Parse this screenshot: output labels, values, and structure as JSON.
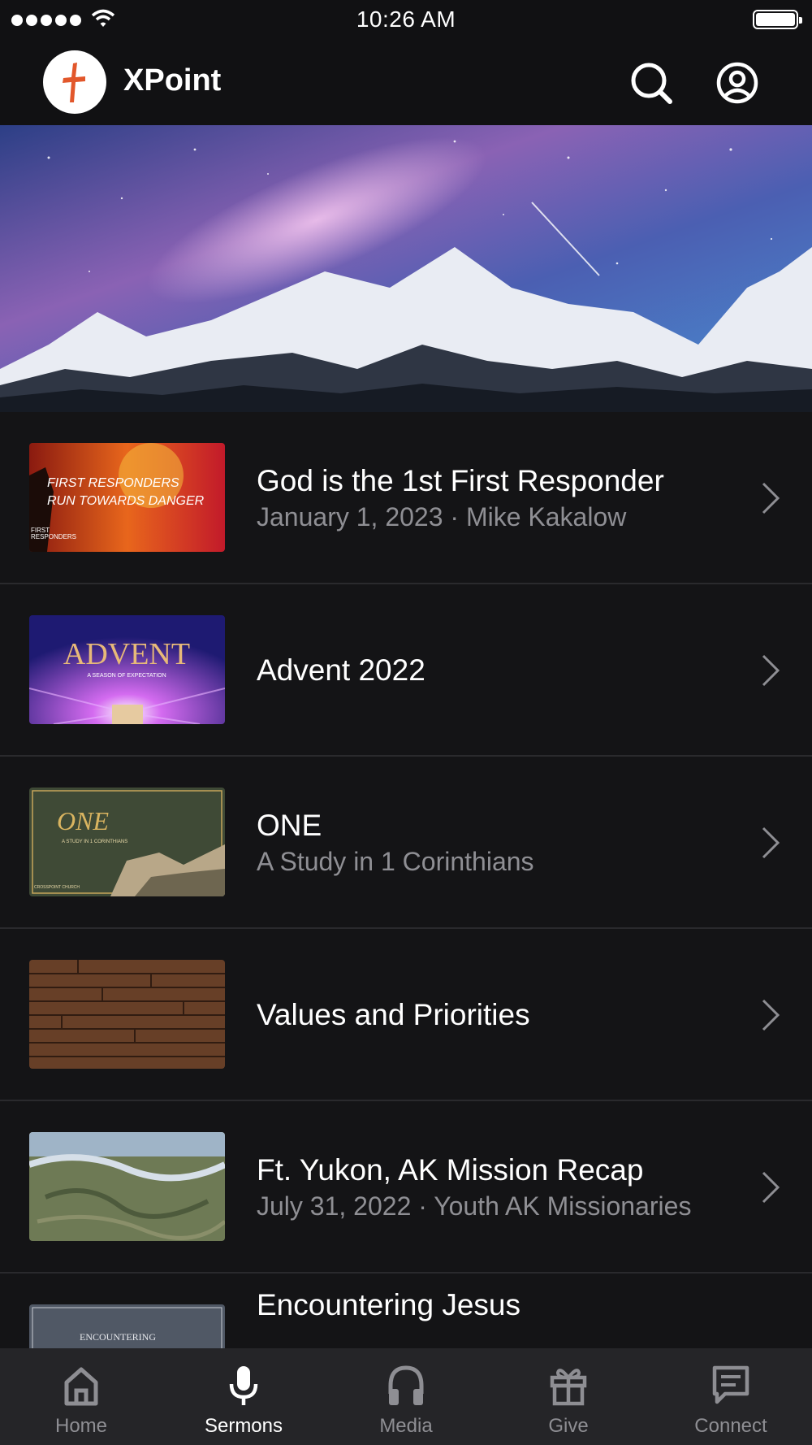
{
  "status_bar": {
    "time": "10:26 AM"
  },
  "header": {
    "app_name": "XPoint"
  },
  "sermons": [
    {
      "title": "God is the 1st First Responder",
      "subtitle": "January 1, 2023 · Mike Kakalow",
      "thumb_text": [
        "FIRST RESPONDERS",
        "RUN TOWARDS DANGER",
        "FIRST",
        "RESPONDERS"
      ]
    },
    {
      "title": "Advent 2022",
      "subtitle": "",
      "thumb_text": [
        "ADVENT",
        "A SEASON OF EXPECTATION"
      ]
    },
    {
      "title": "ONE",
      "subtitle": "A Study in 1 Corinthians",
      "thumb_text": [
        "ONE",
        "A STUDY IN 1 CORINTHIANS",
        "CROSSPOINT CHURCH"
      ]
    },
    {
      "title": "Values and Priorities",
      "subtitle": "",
      "thumb_text": []
    },
    {
      "title": "Ft. Yukon, AK Mission Recap",
      "subtitle": "July 31, 2022 · Youth AK Missionaries",
      "thumb_text": []
    },
    {
      "title": "Encountering Jesus",
      "subtitle": "",
      "thumb_text": [
        "ENCOUNTERING"
      ]
    }
  ],
  "tabs": [
    {
      "label": "Home",
      "icon": "home-icon"
    },
    {
      "label": "Sermons",
      "icon": "microphone-icon",
      "active": true
    },
    {
      "label": "Media",
      "icon": "headphones-icon"
    },
    {
      "label": "Give",
      "icon": "gift-icon"
    },
    {
      "label": "Connect",
      "icon": "chat-icon"
    }
  ],
  "colors": {
    "background": "#141416",
    "tabbar": "#252528",
    "accent_logo": "#e2572b",
    "muted_text": "#8f8f94"
  }
}
